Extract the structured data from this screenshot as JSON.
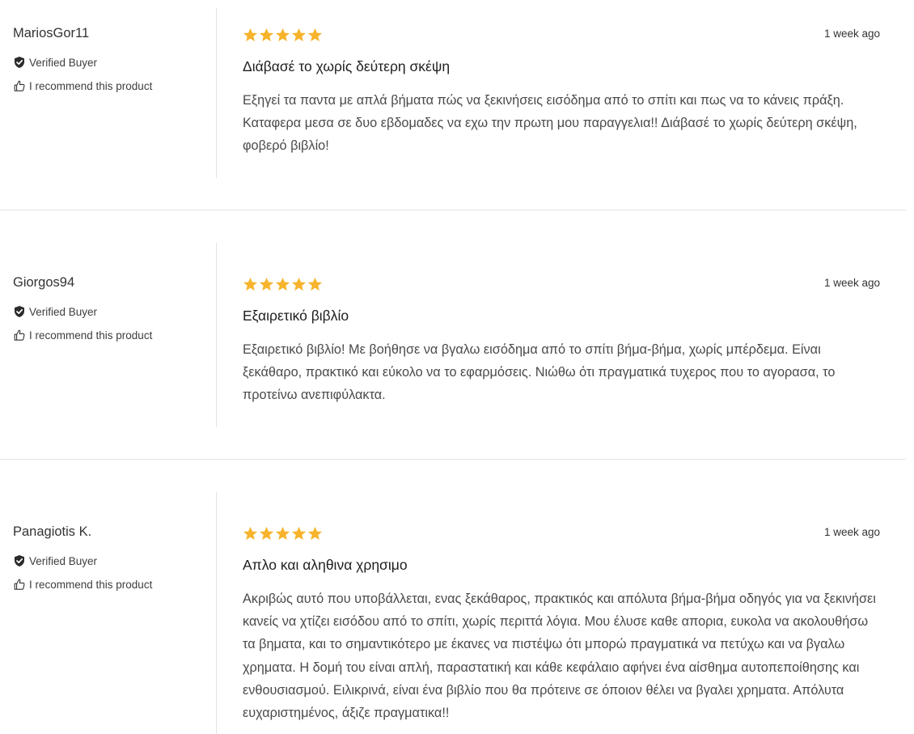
{
  "colors": {
    "star": "#f7b32b",
    "divider": "#e3e3e3",
    "text": "#333333"
  },
  "icons": {
    "verified": "shield-check-icon",
    "recommend": "thumbs-up-icon",
    "rating": "star-icon"
  },
  "reviews": [
    {
      "author": "MariosGor11",
      "verified_label": "Verified Buyer",
      "recommend_label": "I recommend this product",
      "rating": 5,
      "date": "1 week ago",
      "title": "Διάβασέ το χωρίς δεύτερη σκέψη",
      "body": "Εξηγεί τα παντα με απλά βήματα πώς να ξεκινήσεις εισόδημα από το σπίτι και πως να το κάνεις πράξη. Καταφερα μεσα σε δυο εβδομαδες να εχω την πρωτη μου παραγγελια!! Διάβασέ το χωρίς δεύτερη σκέψη, φοβερό βιβλίο!"
    },
    {
      "author": "Giorgos94",
      "verified_label": "Verified Buyer",
      "recommend_label": "I recommend this product",
      "rating": 5,
      "date": "1 week ago",
      "title": "Εξαιρετικό βιβλίο",
      "body": "Εξαιρετικό βιβλίο! Με βοήθησε να βγαλω εισόδημα από το σπίτι βήμα-βήμα, χωρίς μπέρδεμα. Είναι ξεκάθαρο, πρακτικό και εύκολο να το εφαρμόσεις. Νιώθω ότι πραγματικά τυχερος που το αγορασα, το προτείνω ανεπιφύλακτα."
    },
    {
      "author": "Panagiotis K.",
      "verified_label": "Verified Buyer",
      "recommend_label": "I recommend this product",
      "rating": 5,
      "date": "1 week ago",
      "title": "Απλο και αληθινα χρησιμο",
      "body": "Ακριβώς αυτό που υποβάλλεται, ενας ξεκάθαρος, πρακτικός και απόλυτα βήμα-βήμα οδηγός για να ξεκινήσει κανείς να χτίζει εισόδου από το σπίτι, χωρίς περιττά λόγια. Μου έλυσε καθε απορια, ευκολα να ακολουθήσω τα βηματα, και το σημαντικότερο με έκανες να πιστέψω ότι μπορώ πραγματικά να πετύχω και να βγαλω χρηματα. Η δομή του είναι απλή, παραστατική και κάθε κεφάλαιο αφήνει ένα αίσθημα αυτοπεποίθησης και ενθουσιασμού. Ειλικρινά, είναι ένα βιβλίο που θα πρότεινε σε όποιον θέλει να βγαλει χρηματα. Απόλυτα ευχαριστημένος, άξιζε πραγματικα!!"
    }
  ]
}
